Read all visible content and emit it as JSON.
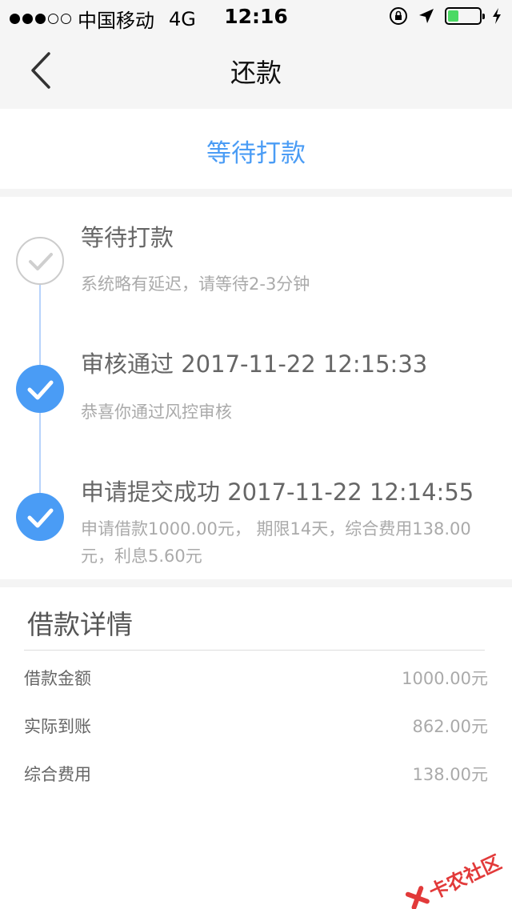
{
  "status_bar": {
    "carrier": "中国移动",
    "network": "4G",
    "time": "12:16",
    "battery_level": 0.35
  },
  "nav": {
    "title": "还款",
    "back_icon": "chevron-left-icon"
  },
  "status_card": {
    "text": "等待打款"
  },
  "timeline": [
    {
      "title": "等待打款",
      "description": "系统略有延迟，请等待2-3分钟",
      "state": "pending"
    },
    {
      "title": "审核通过 2017-11-22 12:15:33",
      "description": "恭喜你通过风控审核",
      "state": "done"
    },
    {
      "title": "申请提交成功 2017-11-22 12:14:55",
      "description": "申请借款1000.00元， 期限14天，综合费用138.00元，利息5.60元",
      "state": "done"
    }
  ],
  "loan_details": {
    "title": "借款详情",
    "rows": [
      {
        "label": "借款金额",
        "value": "1000.00元"
      },
      {
        "label": "实际到账",
        "value": "862.00元"
      },
      {
        "label": "综合费用",
        "value": "138.00元"
      }
    ]
  },
  "watermark": {
    "text": "卡农社区"
  },
  "colors": {
    "accent": "#4a9cf5",
    "timeline_line": "#b8d3fb",
    "pending_circle": "#cccccc",
    "battery": "#4cd964",
    "watermark": "#e23a3a"
  }
}
